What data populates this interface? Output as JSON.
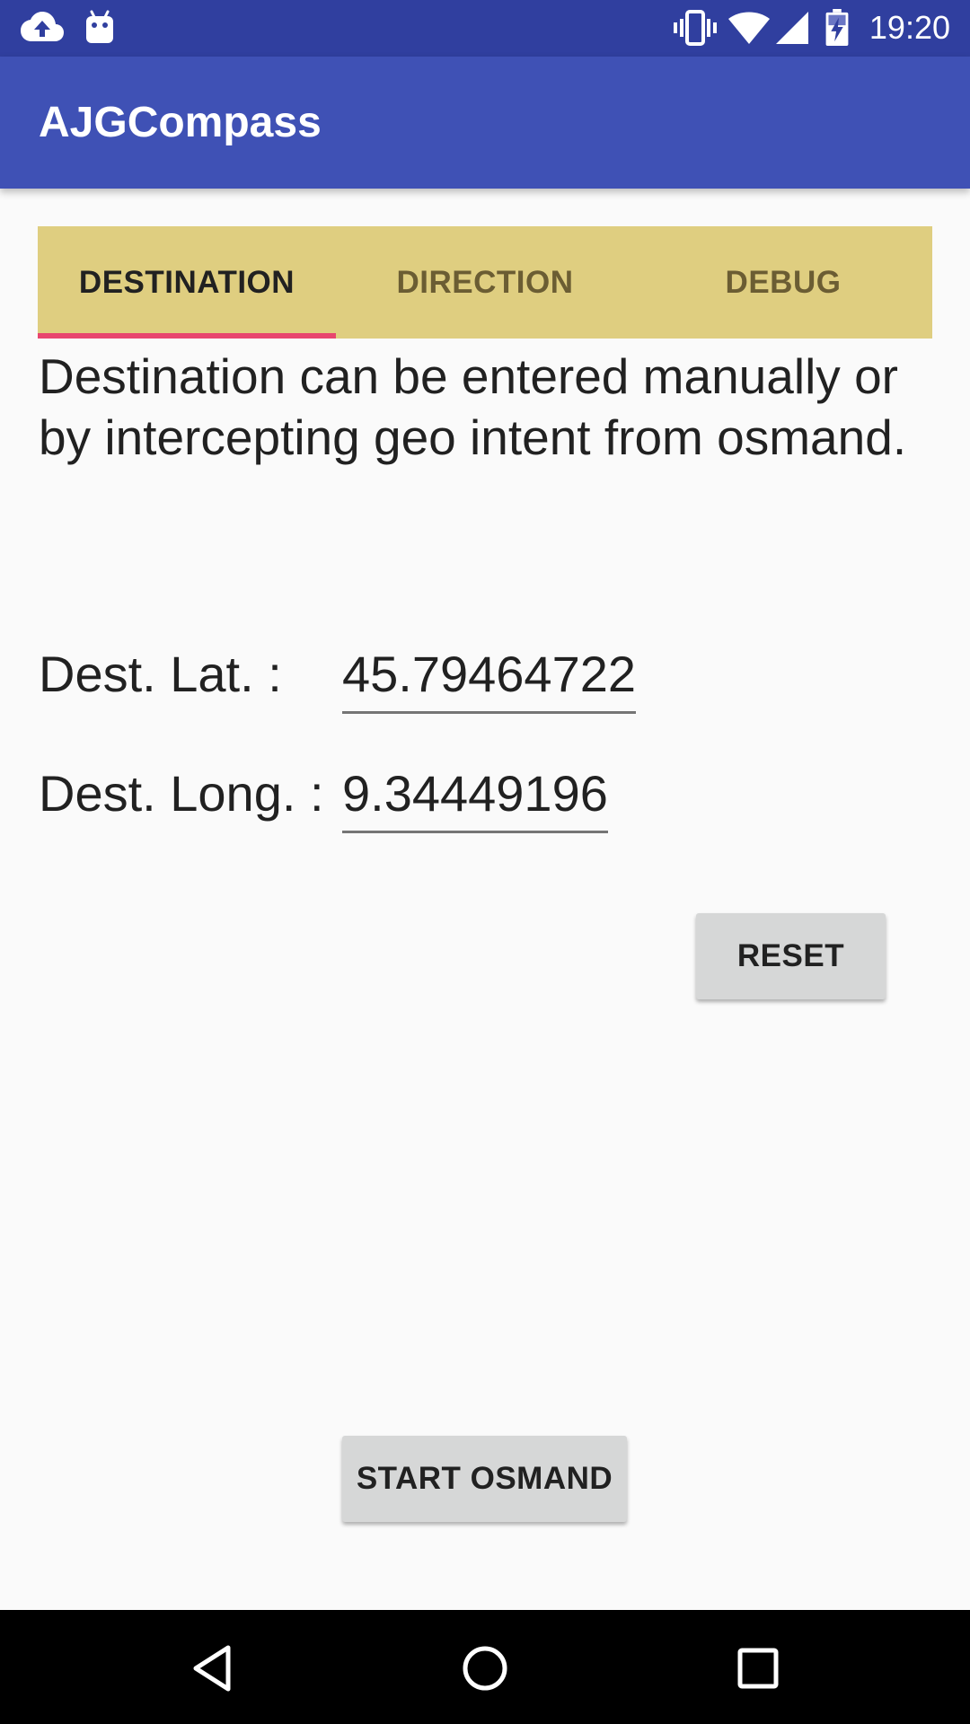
{
  "status_bar": {
    "time": "19:20",
    "icons": [
      "cloud-upload-icon",
      "android-icon",
      "vibrate-icon",
      "wifi-icon",
      "cell-signal-icon",
      "battery-charging-icon"
    ]
  },
  "app_bar": {
    "title": "AJGCompass"
  },
  "tabs": [
    {
      "label": "DESTINATION",
      "active": true
    },
    {
      "label": "DIRECTION",
      "active": false
    },
    {
      "label": "DEBUG",
      "active": false
    }
  ],
  "description": "Destination can be entered manually or by intercepting geo intent from osmand.",
  "fields": {
    "lat": {
      "label": "Dest. Lat. :",
      "value": "45.79464722"
    },
    "long": {
      "label": "Dest. Long. :",
      "value": "9.34449196"
    }
  },
  "buttons": {
    "reset": "RESET",
    "start_osmand": "START OSMAND"
  },
  "nav_bar": {
    "icons": [
      "back-icon",
      "home-icon",
      "recents-icon"
    ]
  },
  "colors": {
    "status_bar": "#303f9f",
    "app_bar": "#3f51b5",
    "tab_bar": "#dfce80",
    "tab_indicator": "#e8466e",
    "button": "#d6d7d7"
  }
}
